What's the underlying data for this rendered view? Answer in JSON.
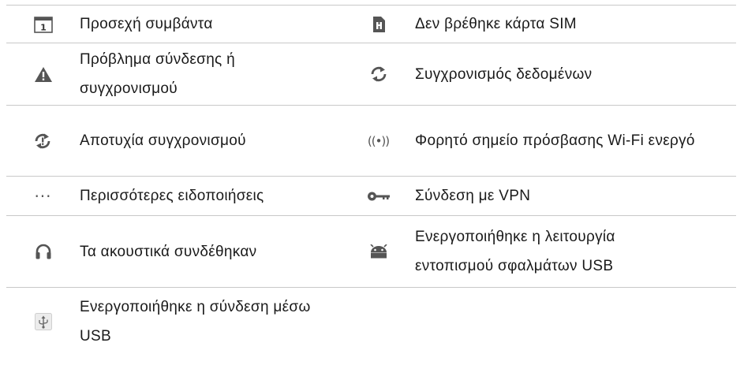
{
  "rows": [
    {
      "left": {
        "icon": "calendar-icon",
        "glyph": "1",
        "text": "Προσεχή συμβάντα"
      },
      "right": {
        "icon": "no-sim-icon",
        "text": "Δεν βρέθηκε κάρτα SIM"
      }
    },
    {
      "left": {
        "icon": "warning-icon",
        "text": "Πρόβλημα σύνδεσης ή συγχρονισμού"
      },
      "right": {
        "icon": "sync-icon",
        "text": "Συγχρονισμός δεδομένων"
      }
    },
    {
      "left": {
        "icon": "sync-error-icon",
        "text": "Αποτυχία συγχρονισμού"
      },
      "right": {
        "icon": "wifi-hotspot-icon",
        "glyph": "((•))",
        "text": "Φορητό σημείο πρόσβασης Wi-Fi ενεργό"
      }
    },
    {
      "left": {
        "icon": "more-notifications-icon",
        "glyph": "···",
        "text": "Περισσότερες ειδοποιήσεις"
      },
      "right": {
        "icon": "vpn-key-icon",
        "text": "Σύνδεση με VPN"
      }
    },
    {
      "left": {
        "icon": "headset-icon",
        "text": "Τα ακουστικά συνδέθηκαν"
      },
      "right": {
        "icon": "android-debug-icon",
        "text": "Ενεργοποιήθηκε η λειτουργία εντοπισμού σφαλμάτων USB"
      }
    },
    {
      "left": {
        "icon": "usb-icon",
        "text": "Ενεργοποιήθηκε η σύνδεση μέσω USB"
      },
      "right": null
    }
  ]
}
